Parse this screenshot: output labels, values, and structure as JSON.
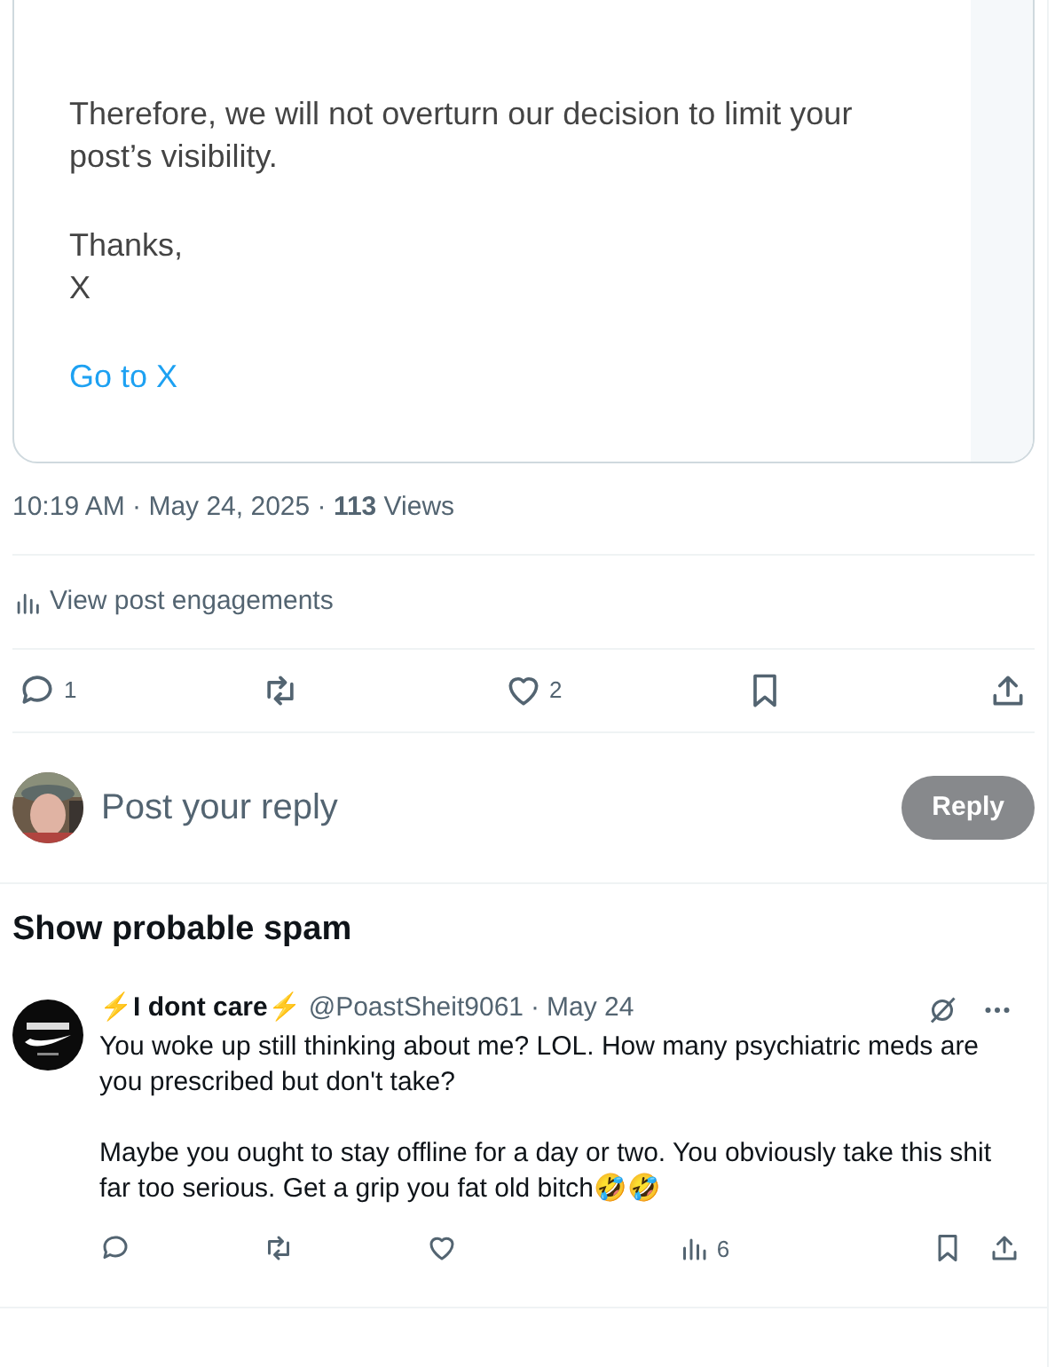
{
  "message_card": {
    "paragraphs": [
      "Therefore, we will not overturn our decision to limit your post’s visibility."
    ],
    "closing": [
      "Thanks,",
      "X"
    ],
    "link": "Go to X"
  },
  "post_meta": "10:19 AM · May 24, 2025 · **113** Views",
  "engagements_link": "View post engagements",
  "actions": [
    {
      "kind": "reply",
      "count": "1"
    },
    {
      "kind": "repost"
    },
    {
      "kind": "like",
      "count": "2"
    },
    {
      "kind": "bookmark"
    },
    {
      "kind": "share"
    }
  ],
  "composer": {
    "placeholder": "Post your reply",
    "button": "Reply",
    "disabled": true
  },
  "spam_section": {
    "title": "Show probable spam",
    "posts": [
      {
        "display_name": "⚡I dont care⚡",
        "handle": "@PoastSheit9061",
        "separator": "·",
        "time": "May 24",
        "paragraphs": [
          "You woke up still thinking about me? LOL. How many psychiatric meds are you prescribed but don't take?",
          "Maybe you ought to stay offline for a day or two. You obviously take this shit far too serious. Get a grip you fat old bitch🤣🤣"
        ],
        "actions": [
          {
            "kind": "reply"
          },
          {
            "kind": "repost"
          },
          {
            "kind": "like"
          },
          {
            "kind": "views",
            "count": "6"
          },
          {
            "kind": "bookmark"
          },
          {
            "kind": "share"
          }
        ]
      }
    ]
  }
}
